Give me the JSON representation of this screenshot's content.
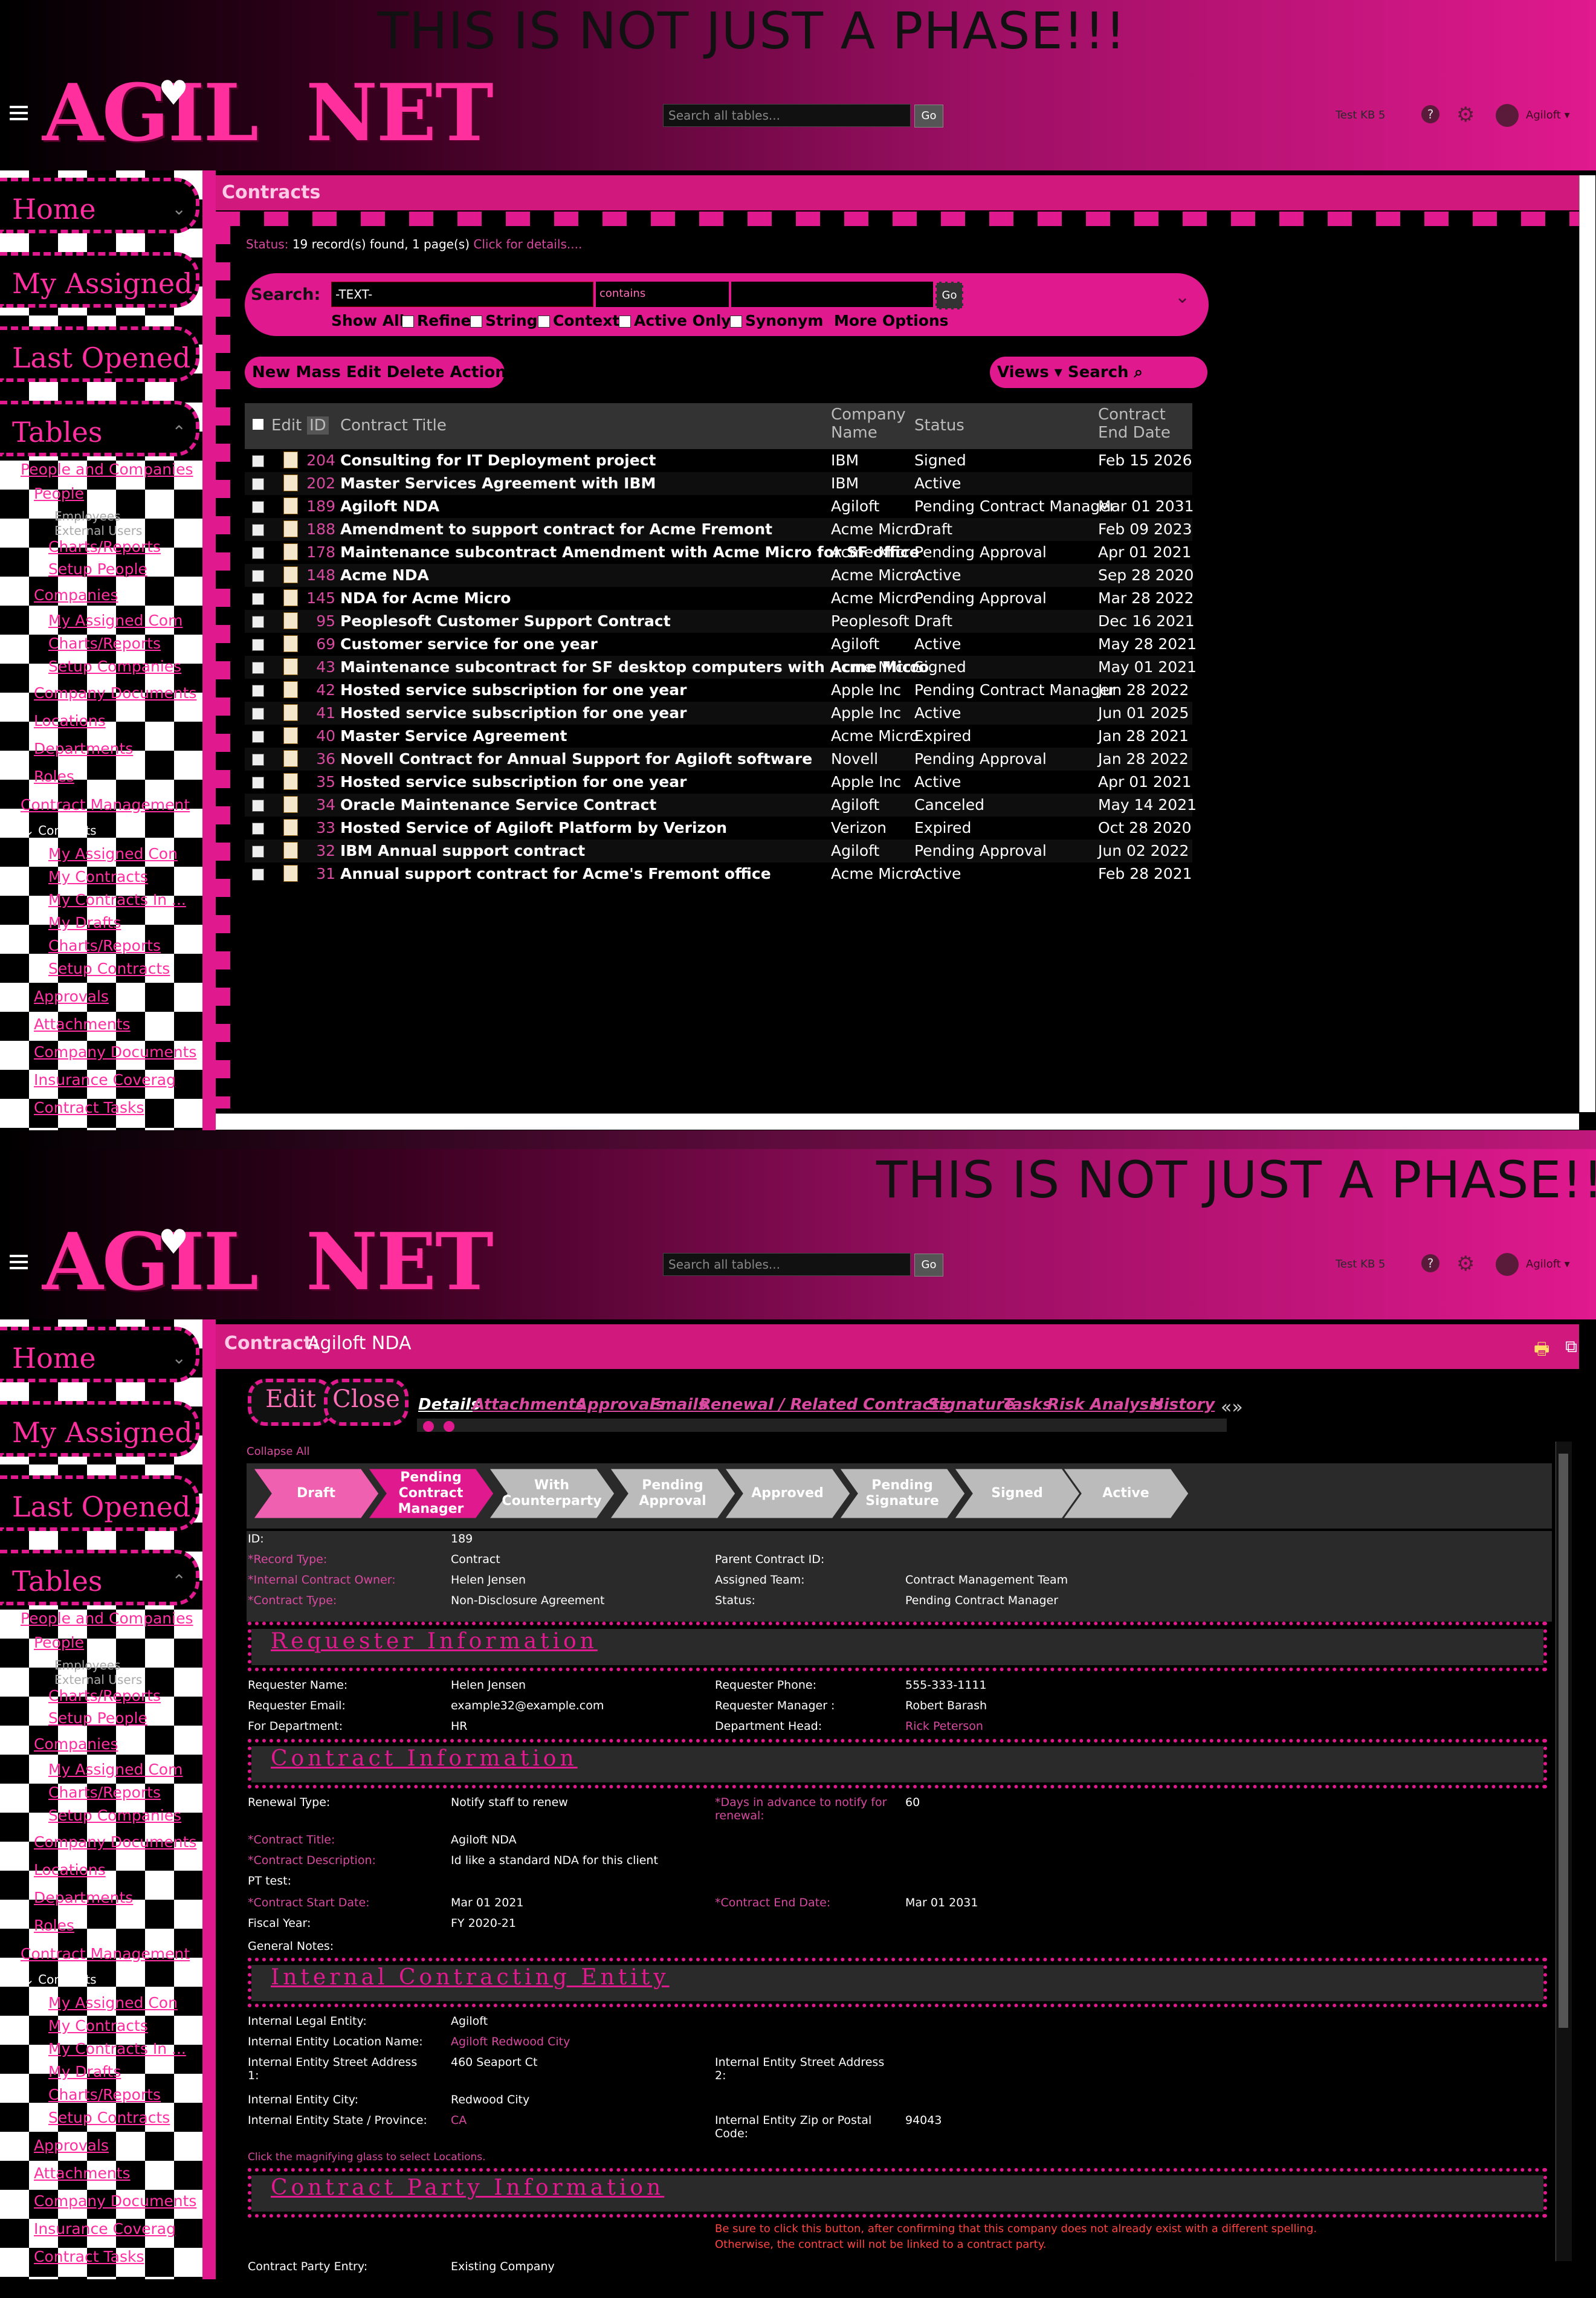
{
  "banner": "THIS IS NOT JUST A PHASE!!!",
  "logo": {
    "text_left": "AGIL",
    "text_right": "NET",
    "heart": "♥"
  },
  "topbar": {
    "search_placeholder": "Search all tables...",
    "go": "Go",
    "kb": "Test KB 5",
    "help": "?",
    "user": "Agiloft"
  },
  "sidebar": {
    "home": "Home",
    "assigned": "My Assigned",
    "opened": "Last Opened",
    "tables": "Tables",
    "tree": {
      "people_companies": "People and Companies",
      "people": "People",
      "employees": "Employees",
      "external_users": "External Users",
      "charts1": "Charts/Reports",
      "setup_people": "Setup People",
      "companies": "Companies",
      "my_assigned_com": "My Assigned Com",
      "charts2": "Charts/Reports",
      "setup_companies": "Setup Companies",
      "company_documents": "Company Documents",
      "locations": "Locations",
      "departments": "Departments",
      "roles": "Roles",
      "contract_management": "Contract Management",
      "contracts": "Contracts",
      "my_assigned_con": "My Assigned Con",
      "my_contracts": "My Contracts",
      "my_contracts_in": "My Contracts In ...",
      "my_drafts": "My Drafts",
      "charts3": "Charts/Reports",
      "setup_contracts": "Setup Contracts",
      "approvals": "Approvals",
      "attachments": "Attachments",
      "company_documents2": "Company Documents",
      "insurance": "Insurance Coverag",
      "contract_tasks": "Contract Tasks"
    }
  },
  "list": {
    "header": "Contracts",
    "status_label": "Status:",
    "status_value": "19 record(s) found, 1 page(s)",
    "status_link": "Click for details....",
    "search": {
      "label": "Search:",
      "text_value": "-TEXT-",
      "op_value": "contains",
      "go": "Go",
      "opts": [
        "Show All",
        "Refine",
        "String",
        "Context",
        "Active Only",
        "Synonym",
        "More Options"
      ]
    },
    "actions": "New Mass Edit Delete Actions",
    "views": "Views",
    "search_small": "Search",
    "columns": {
      "edit": "Edit",
      "id": "ID",
      "title": "Contract Title",
      "company1": "Company",
      "company2": "Name",
      "status": "Status",
      "end1": "Contract",
      "end2": "End Date"
    },
    "rows": [
      {
        "id": "204",
        "title": "Consulting for IT Deployment project",
        "company": "IBM",
        "status": "Signed",
        "end": "Feb 15 2026"
      },
      {
        "id": "202",
        "title": "Master Services Agreement with IBM",
        "company": "IBM",
        "status": "Active",
        "end": ""
      },
      {
        "id": "189",
        "title": "Agiloft NDA",
        "company": "Agiloft",
        "status": "Pending Contract Manager",
        "end": "Mar 01 2031"
      },
      {
        "id": "188",
        "title": "Amendment to support contract for Acme Fremont",
        "company": "Acme Micro",
        "status": "Draft",
        "end": "Feb 09 2023"
      },
      {
        "id": "178",
        "title": "Maintenance subcontract Amendment with Acme Micro for SF office",
        "company": "Acme Micro",
        "status": "Pending Approval",
        "end": "Apr 01 2021"
      },
      {
        "id": "148",
        "title": "Acme NDA",
        "company": "Acme Micro",
        "status": "Active",
        "end": "Sep 28 2020"
      },
      {
        "id": "145",
        "title": "NDA for Acme Micro",
        "company": "Acme Micro",
        "status": "Pending Approval",
        "end": "Mar 28 2022"
      },
      {
        "id": "95",
        "title": "Peoplesoft Customer Support Contract",
        "company": "Peoplesoft",
        "status": "Draft",
        "end": "Dec 16 2021"
      },
      {
        "id": "69",
        "title": "Customer service for one year",
        "company": "Agiloft",
        "status": "Active",
        "end": "May 28 2021"
      },
      {
        "id": "43",
        "title": "Maintenance subcontract for SF desktop computers with Acme Micro",
        "company": "Acme Micro",
        "status": "Signed",
        "end": "May 01 2021"
      },
      {
        "id": "42",
        "title": "Hosted service subscription for one year",
        "company": "Apple Inc",
        "status": "Pending Contract Manager",
        "end": "Jun 28 2022"
      },
      {
        "id": "41",
        "title": "Hosted service subscription for one year",
        "company": "Apple Inc",
        "status": "Active",
        "end": "Jun 01 2025"
      },
      {
        "id": "40",
        "title": "Master Service Agreement",
        "company": "Acme Micro",
        "status": "Expired",
        "end": "Jan 28 2021"
      },
      {
        "id": "36",
        "title": "Novell Contract for Annual Support for Agiloft software",
        "company": "Novell",
        "status": "Pending Approval",
        "end": "Jan 28 2022"
      },
      {
        "id": "35",
        "title": "Hosted service subscription for one year",
        "company": "Apple Inc",
        "status": "Active",
        "end": "Apr 01 2021"
      },
      {
        "id": "34",
        "title": "Oracle Maintenance Service Contract",
        "company": "Agiloft",
        "status": "Canceled",
        "end": "May 14 2021"
      },
      {
        "id": "33",
        "title": "Hosted Service of Agiloft Platform by Verizon",
        "company": "Verizon",
        "status": "Expired",
        "end": "Oct 28 2020"
      },
      {
        "id": "32",
        "title": "IBM Annual support contract",
        "company": "Agiloft",
        "status": "Pending Approval",
        "end": "Jun 02 2022"
      },
      {
        "id": "31",
        "title": "Annual support contract for Acme's Fremont office",
        "company": "Acme Micro",
        "status": "Active",
        "end": "Feb 28 2021"
      }
    ]
  },
  "record": {
    "header_label": "Contract:",
    "header_title": "Agiloft NDA",
    "edit": "Edit",
    "close": "Close",
    "tabs": [
      "Details",
      "Attachments",
      "Approvals",
      "Emails",
      "Renewal / Related Contracts",
      "Signature",
      "Tasks",
      "Risk Analysis",
      "History"
    ],
    "collapse_all": "Collapse All",
    "stages": [
      {
        "l1": "Draft",
        "l2": "",
        "l3": ""
      },
      {
        "l1": "Pending",
        "l2": "Contract",
        "l3": "Manager"
      },
      {
        "l1": "With",
        "l2": "Counterparty",
        "l3": ""
      },
      {
        "l1": "Pending",
        "l2": "Approval",
        "l3": ""
      },
      {
        "l1": "Approved",
        "l2": "",
        "l3": ""
      },
      {
        "l1": "Pending",
        "l2": "Signature",
        "l3": ""
      },
      {
        "l1": "Signed",
        "l2": "",
        "l3": ""
      },
      {
        "l1": "Active",
        "l2": "",
        "l3": ""
      }
    ],
    "labels": {
      "id": "ID:",
      "record_type": "*Record Type:",
      "internal_owner": "*Internal Contract Owner:",
      "contract_type": "*Contract Type:",
      "parent_id": "Parent Contract ID:",
      "assigned_team": "Assigned Team:",
      "status": "Status:",
      "req_name": "Requester Name:",
      "req_email": "Requester Email:",
      "for_dept": "For Department:",
      "req_phone": "Requester Phone:",
      "req_manager": "Requester Manager :",
      "dept_head": "Department Head:",
      "renewal_type": "Renewal Type:",
      "days_advance_1": "*Days in advance to notify for",
      "days_advance_2": "renewal:",
      "contract_title": "*Contract Title:",
      "contract_desc": "*Contract Description:",
      "pt_test": "PT test:",
      "start_date": "*Contract Start Date:",
      "end_date": "*Contract End Date:",
      "fiscal_year": "Fiscal Year:",
      "general_notes": "General Notes:",
      "legal_entity": "Internal Legal Entity:",
      "entity_location": "Internal Entity Location Name:",
      "street1_a": "Internal Entity Street Address",
      "street1_b": "1:",
      "street2_a": "Internal Entity Street Address",
      "street2_b": "2:",
      "city": "Internal Entity City:",
      "state": "Internal Entity State / Province:",
      "zip_a": "Internal Entity Zip or Postal",
      "zip_b": "Code:",
      "party_entry": "Contract Party Entry:"
    },
    "values": {
      "id": "189",
      "record_type": "Contract",
      "internal_owner": "Helen Jensen",
      "contract_type": "Non-Disclosure Agreement",
      "assigned_team": "Contract Management Team",
      "status": "Pending Contract Manager",
      "req_name": "Helen Jensen",
      "req_email": "example32@example.com",
      "for_dept": "HR",
      "req_phone": "555-333-1111",
      "req_manager": "Robert Barash",
      "dept_head": "Rick Peterson",
      "renewal_type": "Notify staff to renew",
      "days_advance": "60",
      "contract_title": "Agiloft NDA",
      "contract_desc": "Id like a standard NDA for this client",
      "start_date": "Mar 01 2021",
      "end_date": "Mar 01 2031",
      "fiscal_year": "FY 2020-21",
      "legal_entity": "Agiloft",
      "entity_location": "Agiloft Redwood City",
      "street1": "460 Seaport Ct",
      "city": "Redwood City",
      "state": "CA",
      "zip": "94043",
      "party_entry": "Existing Company"
    },
    "sections": {
      "requester": "Requester Information",
      "contract": "Contract Information",
      "internal": "Internal Contracting Entity",
      "party": "Contract Party Information"
    },
    "notes": {
      "magnify": "Click the magnifying glass to select Locations.",
      "party_warn_1": "Be sure to click this button, after confirming that this company does not already exist with a different spelling.",
      "party_warn_2": "Otherwise, the contract will not be linked to a contract party."
    }
  }
}
